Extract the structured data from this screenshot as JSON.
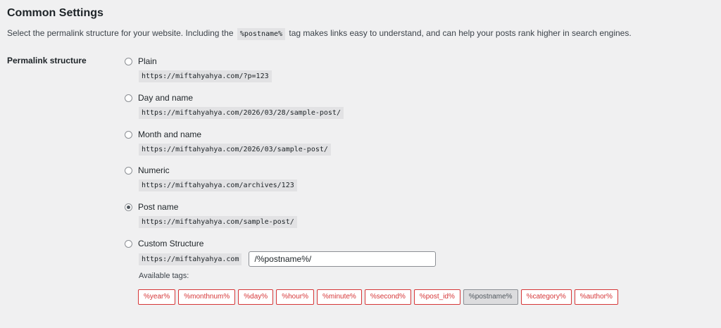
{
  "section": {
    "title": "Common Settings",
    "intro_before": "Select the permalink structure for your website. Including the",
    "intro_code": "%postname%",
    "intro_after": "tag makes links easy to understand, and can help your posts rank higher in search engines."
  },
  "permalink": {
    "label": "Permalink structure",
    "options": [
      {
        "label": "Plain",
        "url": "https://miftahyahya.com/?p=123",
        "checked": false
      },
      {
        "label": "Day and name",
        "url": "https://miftahyahya.com/2026/03/28/sample-post/",
        "checked": false
      },
      {
        "label": "Month and name",
        "url": "https://miftahyahya.com/2026/03/sample-post/",
        "checked": false
      },
      {
        "label": "Numeric",
        "url": "https://miftahyahya.com/archives/123",
        "checked": false
      },
      {
        "label": "Post name",
        "url": "https://miftahyahya.com/sample-post/",
        "checked": true
      },
      {
        "label": "Custom Structure",
        "checked": false
      }
    ],
    "custom": {
      "prefix": "https://miftahyahya.com",
      "value": "/%postname%/"
    },
    "available_tags_label": "Available tags:",
    "tags": [
      {
        "label": "%year%",
        "active": false
      },
      {
        "label": "%monthnum%",
        "active": false
      },
      {
        "label": "%day%",
        "active": false
      },
      {
        "label": "%hour%",
        "active": false
      },
      {
        "label": "%minute%",
        "active": false
      },
      {
        "label": "%second%",
        "active": false
      },
      {
        "label": "%post_id%",
        "active": false
      },
      {
        "label": "%postname%",
        "active": true
      },
      {
        "label": "%category%",
        "active": false
      },
      {
        "label": "%author%",
        "active": false
      }
    ]
  }
}
